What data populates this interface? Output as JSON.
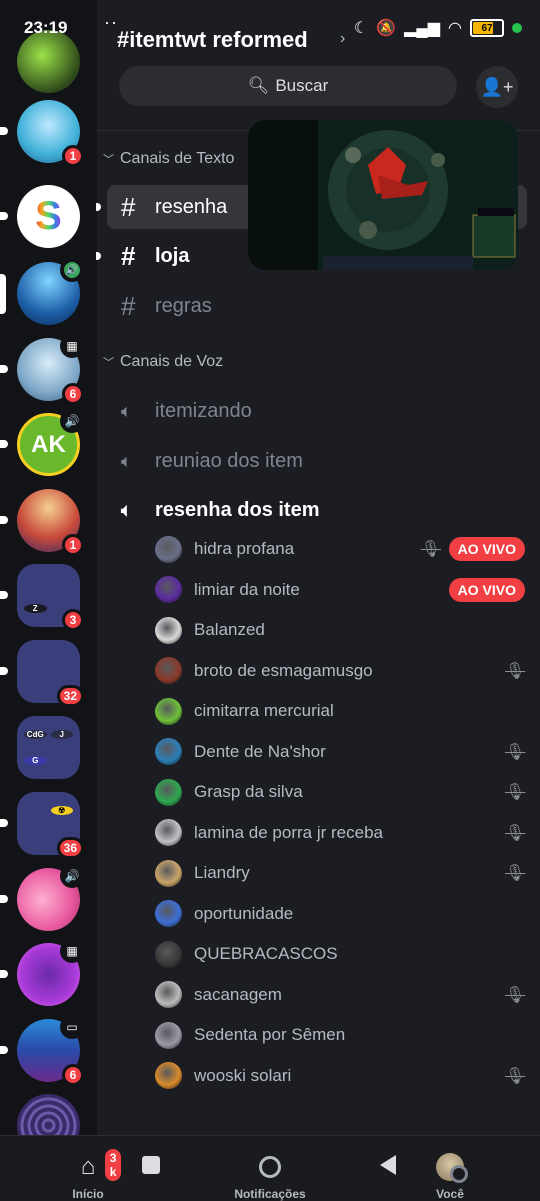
{
  "status_bar": {
    "time": "23:19",
    "battery": "67"
  },
  "guild": {
    "name": "#itemtwt reformed"
  },
  "search": {
    "label": "Buscar"
  },
  "categories": {
    "text": "Canais de Texto",
    "voice": "Canais de Voz"
  },
  "text_channels": [
    {
      "name": "resenha",
      "state": "active"
    },
    {
      "name": "loja",
      "state": "unread"
    },
    {
      "name": "regras",
      "state": "read"
    }
  ],
  "voice_channels": [
    {
      "name": "itemizando"
    },
    {
      "name": "reuniao dos item"
    },
    {
      "name": "resenha dos item"
    }
  ],
  "voice_users": [
    {
      "name": "hidra profana",
      "muted": true,
      "live": "AO VIVO",
      "avatar_color": "#6a6f8a"
    },
    {
      "name": "limiar da noite",
      "muted": false,
      "live": "AO VIVO",
      "avatar_color": "#5b2ca0"
    },
    {
      "name": "Balanzed",
      "muted": false,
      "live": "",
      "avatar_color": "#d8d8d8"
    },
    {
      "name": "broto de esmagamusgo",
      "muted": true,
      "live": "",
      "avatar_color": "#8a3a2a"
    },
    {
      "name": "cimitarra mercurial",
      "muted": false,
      "live": "",
      "avatar_color": "#6fbf3a"
    },
    {
      "name": "Dente de Na'shor",
      "muted": true,
      "live": "",
      "avatar_color": "#2d7fb8"
    },
    {
      "name": "Grasp da silva",
      "muted": true,
      "live": "",
      "avatar_color": "#2fa84f"
    },
    {
      "name": "lamina de porra jr receba",
      "muted": true,
      "live": "",
      "avatar_color": "#c0c0c8"
    },
    {
      "name": "Liandry",
      "muted": true,
      "live": "",
      "avatar_color": "#c9a46a"
    },
    {
      "name": "oportunidade",
      "muted": false,
      "live": "",
      "avatar_color": "#3d6fd6"
    },
    {
      "name": "QUEBRACASCOS",
      "muted": false,
      "live": "",
      "avatar_color": "#3a3a3a"
    },
    {
      "name": "sacanagem",
      "muted": true,
      "live": "",
      "avatar_color": "#bcbcbc"
    },
    {
      "name": "Sedenta por Sêmen",
      "muted": false,
      "live": "",
      "avatar_color": "#9a9aa6"
    },
    {
      "name": "wooski solari",
      "muted": true,
      "live": "",
      "avatar_color": "#d88a2a"
    }
  ],
  "servers": [
    {
      "icon": "slime-server-icon",
      "badge": "",
      "color": "#4a7a2a"
    },
    {
      "icon": "anime-boy-server-icon",
      "badge": "1",
      "color": "#3fb0d8"
    },
    {
      "icon": "rainbow-s-server-icon",
      "badge": "",
      "color": "#ffffff",
      "text": "S"
    },
    {
      "icon": "blue-character-server-icon",
      "badge": "",
      "color": "#1d5fa8",
      "status": "speaker"
    },
    {
      "icon": "slime-rimuru-server-icon",
      "badge": "6",
      "color": "#7fa8c8",
      "status": "event"
    },
    {
      "icon": "ak-server-icon",
      "badge": "",
      "color": "#6ab82c",
      "text": "AK",
      "status": "speaker"
    },
    {
      "icon": "luffy-server-icon",
      "badge": "1",
      "color": "#c84a3a"
    },
    {
      "icon": "folder-1-icon",
      "badge": "3",
      "folder": true
    },
    {
      "icon": "folder-2-icon",
      "badge": "32",
      "folder": true
    },
    {
      "icon": "folder-3-icon",
      "badge": "",
      "folder": true,
      "labels": [
        "CdG",
        "J",
        "G"
      ]
    },
    {
      "icon": "folder-4-icon",
      "badge": "36",
      "folder": true
    },
    {
      "icon": "pinkie-server-icon",
      "badge": "",
      "color": "#e85aa0",
      "status": "speaker"
    },
    {
      "icon": "purple-bot-server-icon",
      "badge": "",
      "color": "#a83ad8",
      "status": "event"
    },
    {
      "icon": "aquarius-server-icon",
      "badge": "6",
      "color": "#2a4aa8",
      "status": "screen"
    },
    {
      "icon": "spiral-server-icon",
      "badge": "",
      "color": "#3a2a6a"
    }
  ],
  "bottom_nav": {
    "home": "Início",
    "home_badge": "3 k",
    "notifications": "Notificações",
    "you": "Você"
  },
  "colors": {
    "accent_live": "#f23f43",
    "background": "#1c1d22",
    "rail": "#121316"
  }
}
